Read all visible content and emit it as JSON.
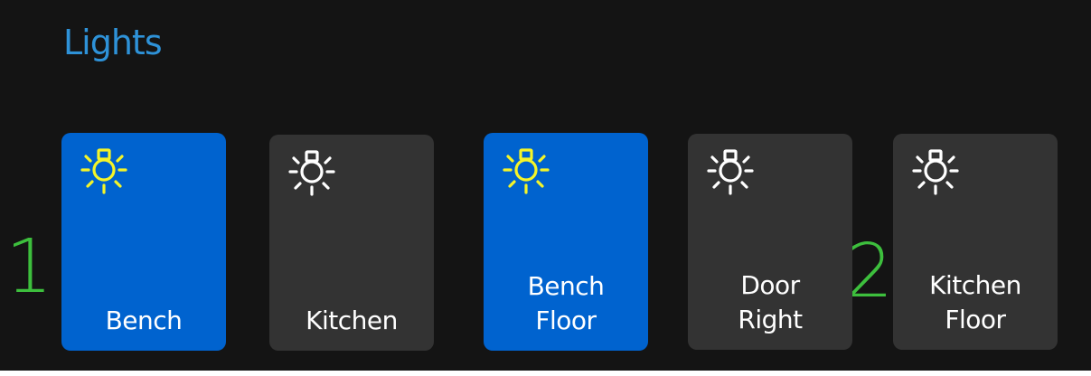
{
  "page": {
    "title": "Lights"
  },
  "markers": [
    "1",
    "2"
  ],
  "colors": {
    "background": "#141414",
    "title": "#2e92d8",
    "tile_on": "#0063cf",
    "tile_off": "#333333",
    "bulb_on": "#f5f528",
    "bulb_off": "#ffffff",
    "marker": "#3dbf3d"
  },
  "tiles": [
    {
      "label_line1": "Bench",
      "label_line2": "",
      "state": "on",
      "icon": "lightbulb-icon"
    },
    {
      "label_line1": "Kitchen",
      "label_line2": "",
      "state": "off",
      "icon": "lightbulb-icon"
    },
    {
      "label_line1": "Bench",
      "label_line2": "Floor",
      "state": "on",
      "icon": "lightbulb-icon"
    },
    {
      "label_line1": "Door",
      "label_line2": "Right",
      "state": "off",
      "icon": "lightbulb-icon"
    },
    {
      "label_line1": "Kitchen",
      "label_line2": "Floor",
      "state": "off",
      "icon": "lightbulb-icon"
    }
  ]
}
